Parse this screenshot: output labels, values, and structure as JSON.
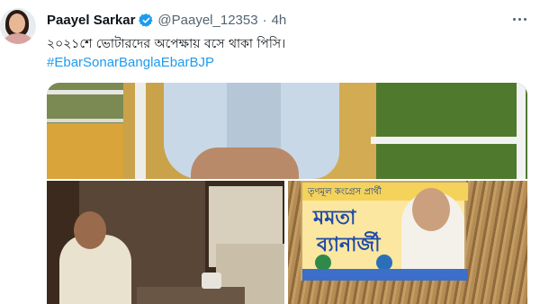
{
  "tweet": {
    "author_name": "Paayel Sarkar",
    "handle": "@Paayel_12353",
    "separator": "·",
    "time": "4h",
    "text": "২০২১শে  ভোটারদের অপেক্ষায় বসে থাকা পিসি।",
    "hashtag": "#EbarSonarBanglaEbarBJP",
    "more_icon": "more-horizontal-icon",
    "verified_icon": "verified-badge-icon"
  },
  "media": {
    "poster_top_text": "তৃণমূল কংগ্রেস প্রার্থী",
    "poster_line1": "মমতা",
    "poster_line2": "ব্যানার্জী"
  },
  "colors": {
    "link": "#1d9bf0",
    "verified": "#1d9bf0",
    "text": "#0f1419",
    "secondary": "#536471"
  }
}
